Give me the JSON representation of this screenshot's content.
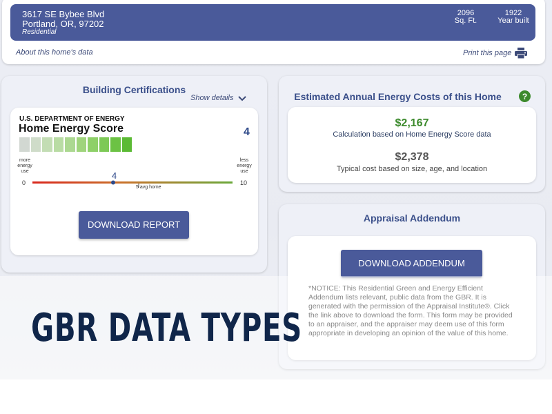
{
  "header": {
    "address_line1": "3617 SE Bybee Blvd",
    "address_line2": "Portland, OR, 97202",
    "property_type": "Residential",
    "sqft_value": "2096",
    "sqft_label": "Sq. Ft.",
    "year_value": "1922",
    "year_label": "Year built",
    "about_link": "About this home's data",
    "print_link": "Print this page"
  },
  "certifications": {
    "title": "Building Certifications",
    "show_details": "Show details",
    "doe_label": "U.S. DEPARTMENT OF ENERGY",
    "score_title": "Home Energy Score",
    "score": "4",
    "score_value": 4,
    "scale_min": "0",
    "scale_max": "10",
    "left_label": "more\nenergy\nuse",
    "right_label": "less\nenergy\nuse",
    "marker_label": "4",
    "avg_label": "5 avg home",
    "avg_value": 5,
    "download_button": "DOWNLOAD REPORT"
  },
  "costs": {
    "title": "Estimated Annual Energy Costs of this Home",
    "home_cost": "$2,167",
    "home_cost_note": "Calculation based on Home Energy Score data",
    "typical_cost": "$2,378",
    "typical_cost_note": "Typical cost based on size, age, and location"
  },
  "appraisal": {
    "title": "Appraisal Addendum",
    "download_button": "DOWNLOAD ADDENDUM",
    "notice": "*NOTICE: This Residential Green and Energy Efficient Addendum lists relevant, public data from the GBR. It is generated with the permission of the Appraisal Institute®. Click the link above to download the form. This form may be provided to an appraiser, and the appraiser may deem use of this form appropriate in developing an opinion of the value of this home."
  },
  "banner": {
    "headline": "GBR DATA TYPES"
  },
  "colors": {
    "brand_blue": "#4a5a9a",
    "cost_green": "#3c8a2c",
    "headline_navy": "#10264a"
  },
  "icons": {
    "print": "printer-icon",
    "chevron": "chevron-down-icon",
    "help": "question-circle-icon"
  }
}
